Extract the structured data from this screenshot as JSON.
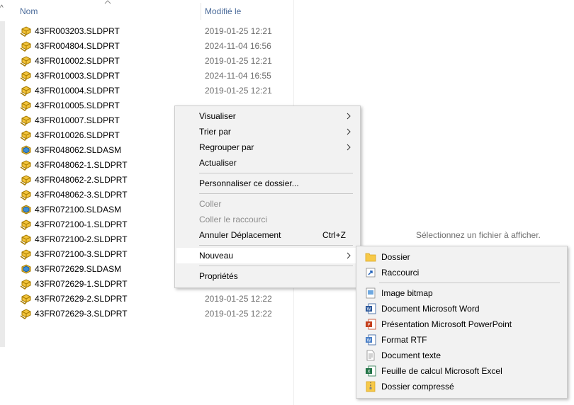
{
  "columns": {
    "name": "Nom",
    "modified": "Modifié le"
  },
  "files": [
    {
      "name": "43FR003203.SLDPRT",
      "date": "2019-01-25 12:21",
      "icon": "sldprt-icon"
    },
    {
      "name": "43FR004804.SLDPRT",
      "date": "2024-11-04 16:56",
      "icon": "sldprt-icon"
    },
    {
      "name": "43FR010002.SLDPRT",
      "date": "2019-01-25 12:21",
      "icon": "sldprt-icon"
    },
    {
      "name": "43FR010003.SLDPRT",
      "date": "2024-11-04 16:55",
      "icon": "sldprt-icon"
    },
    {
      "name": "43FR010004.SLDPRT",
      "date": "2019-01-25 12:21",
      "icon": "sldprt-icon"
    },
    {
      "name": "43FR010005.SLDPRT",
      "date": "",
      "icon": "sldprt-icon"
    },
    {
      "name": "43FR010007.SLDPRT",
      "date": "",
      "icon": "sldprt-icon"
    },
    {
      "name": "43FR010026.SLDPRT",
      "date": "",
      "icon": "sldprt-icon"
    },
    {
      "name": "43FR048062.SLDASM",
      "date": "",
      "icon": "sldasm-icon"
    },
    {
      "name": "43FR048062-1.SLDPRT",
      "date": "",
      "icon": "sldprt-icon"
    },
    {
      "name": "43FR048062-2.SLDPRT",
      "date": "",
      "icon": "sldprt-icon"
    },
    {
      "name": "43FR048062-3.SLDPRT",
      "date": "",
      "icon": "sldprt-icon"
    },
    {
      "name": "43FR072100.SLDASM",
      "date": "",
      "icon": "sldasm-icon"
    },
    {
      "name": "43FR072100-1.SLDPRT",
      "date": "",
      "icon": "sldprt-icon"
    },
    {
      "name": "43FR072100-2.SLDPRT",
      "date": "",
      "icon": "sldprt-icon"
    },
    {
      "name": "43FR072100-3.SLDPRT",
      "date": "",
      "icon": "sldprt-icon"
    },
    {
      "name": "43FR072629.SLDASM",
      "date": "",
      "icon": "sldasm-icon"
    },
    {
      "name": "43FR072629-1.SLDPRT",
      "date": "",
      "icon": "sldprt-icon"
    },
    {
      "name": "43FR072629-2.SLDPRT",
      "date": "2019-01-25 12:22",
      "icon": "sldprt-icon"
    },
    {
      "name": "43FR072629-3.SLDPRT",
      "date": "2019-01-25 12:22",
      "icon": "sldprt-icon"
    }
  ],
  "preview_message": "Sélectionnez un fichier à afficher.",
  "context_menu": {
    "visualiser": "Visualiser",
    "trier_par": "Trier par",
    "regrouper_par": "Regrouper par",
    "actualiser": "Actualiser",
    "personnaliser": "Personnaliser ce dossier...",
    "coller": "Coller",
    "coller_raccourci": "Coller le raccourci",
    "annuler": "Annuler Déplacement",
    "annuler_shortcut": "Ctrl+Z",
    "nouveau": "Nouveau",
    "proprietes": "Propriétés"
  },
  "submenu": {
    "dossier": "Dossier",
    "raccourci": "Raccourci",
    "image_bitmap": "Image bitmap",
    "word": "Document Microsoft Word",
    "powerpoint": "Présentation Microsoft PowerPoint",
    "rtf": "Format RTF",
    "texte": "Document texte",
    "excel": "Feuille de calcul Microsoft Excel",
    "compresse": "Dossier compressé"
  },
  "colors": {
    "header_text": "#4a6a99",
    "date_text": "#6d6d6d",
    "menu_bg": "#f2f2f2"
  }
}
